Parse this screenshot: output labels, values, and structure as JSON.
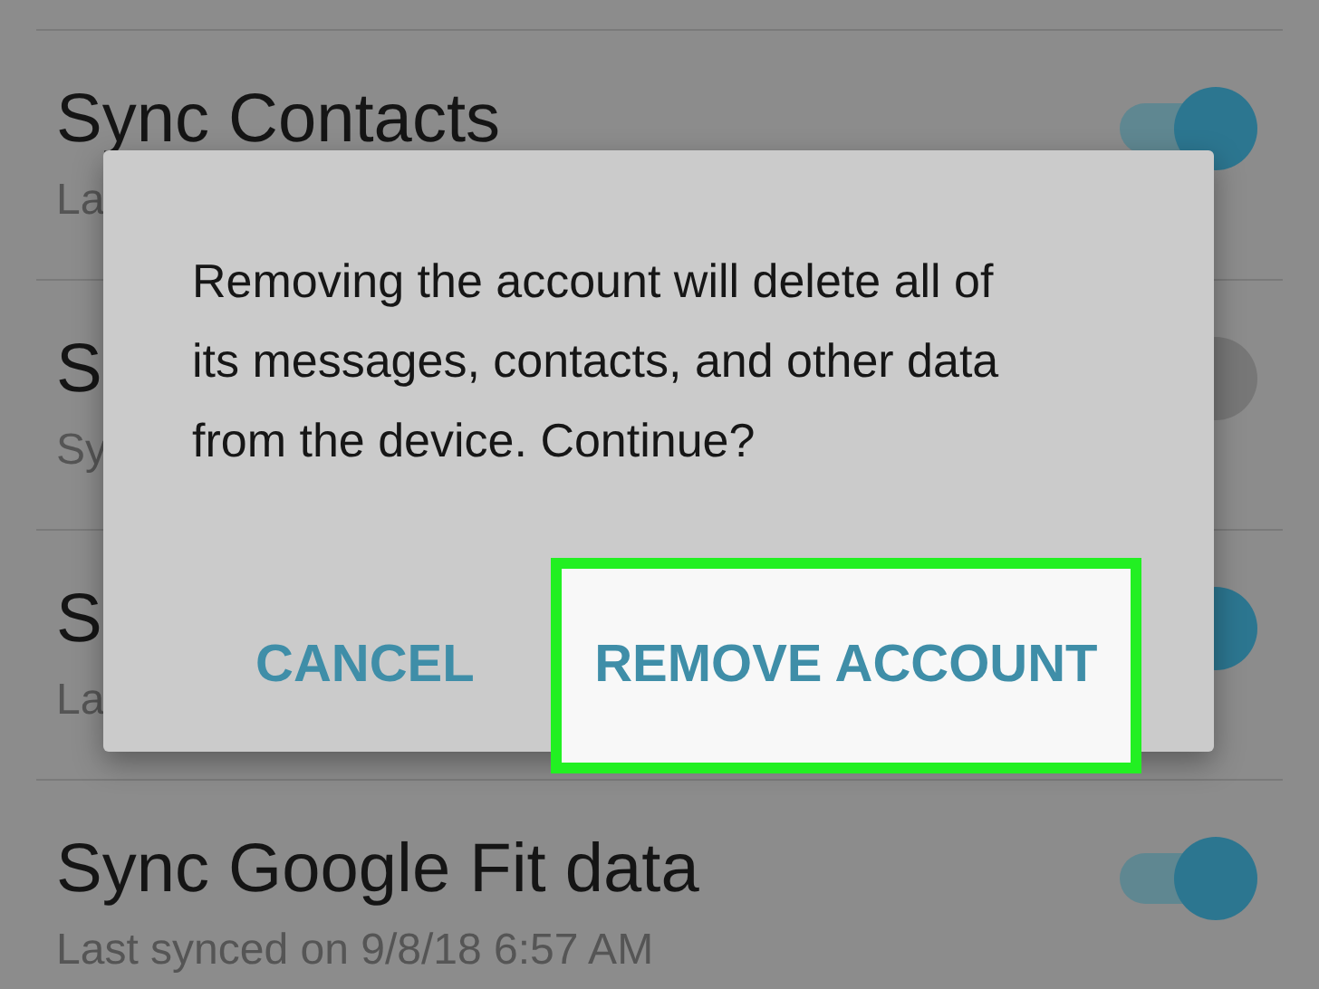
{
  "settings": [
    {
      "title": "Sync Contacts",
      "subtitle": "La",
      "on": true
    },
    {
      "title": "S",
      "subtitle": "Sy",
      "on": false
    },
    {
      "title": "S",
      "subtitle": "La",
      "on": true
    },
    {
      "title": "Sync Google Fit data",
      "subtitle": "Last synced on 9/8/18  6:57 AM",
      "on": true
    }
  ],
  "dialog": {
    "message": "Removing the account will delete all of its messages, contacts, and other data from the device. Continue?",
    "buttons": [
      {
        "label": "CANCEL",
        "highlighted": false
      },
      {
        "label": "REMOVE ACCOUNT",
        "highlighted": true
      }
    ]
  }
}
